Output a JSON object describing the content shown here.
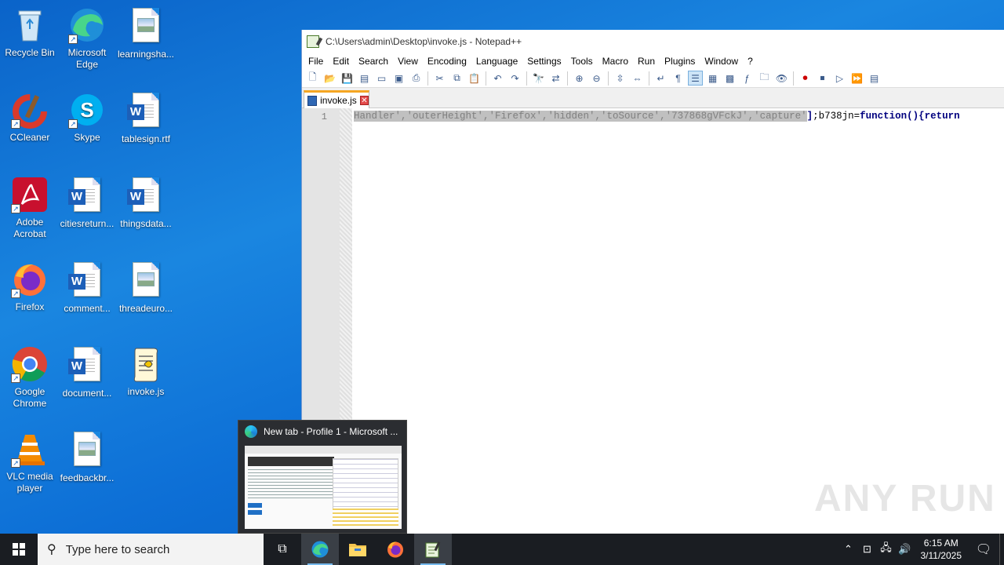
{
  "desktop": {
    "icons": [
      {
        "label": "Recycle Bin"
      },
      {
        "label": "Microsoft Edge"
      },
      {
        "label": "learningsha..."
      },
      {
        "label": "CCleaner"
      },
      {
        "label": "Skype"
      },
      {
        "label": "tablesign.rtf"
      },
      {
        "label": "Adobe Acrobat"
      },
      {
        "label": "citiesreturn..."
      },
      {
        "label": "thingsdata..."
      },
      {
        "label": "Firefox"
      },
      {
        "label": "comment..."
      },
      {
        "label": "threadeuro..."
      },
      {
        "label": "Google Chrome"
      },
      {
        "label": "document..."
      },
      {
        "label": "invoke.js"
      },
      {
        "label": "VLC media player"
      },
      {
        "label": "feedbackbr..."
      }
    ]
  },
  "notepad": {
    "title": "C:\\Users\\admin\\Desktop\\invoke.js - Notepad++",
    "menu": [
      "File",
      "Edit",
      "Search",
      "View",
      "Encoding",
      "Language",
      "Settings",
      "Tools",
      "Macro",
      "Run",
      "Plugins",
      "Window",
      "?"
    ],
    "tab_label": "invoke.js",
    "line_number": "1",
    "code_selected": "Handler','outerHeight','Firefox','hidden','toSource','737868gVFckJ','capture'",
    "code_bracket": "]",
    "code_rest_ident": ";b738jn=",
    "code_kw1": "function",
    "code_paren": "(){",
    "code_kw2": "return"
  },
  "preview": {
    "title": "New tab - Profile 1 - Microsoft ..."
  },
  "taskbar": {
    "search_placeholder": "Type here to search",
    "time": "6:15 AM",
    "date": "3/11/2025"
  },
  "watermark": "ANY RUN"
}
